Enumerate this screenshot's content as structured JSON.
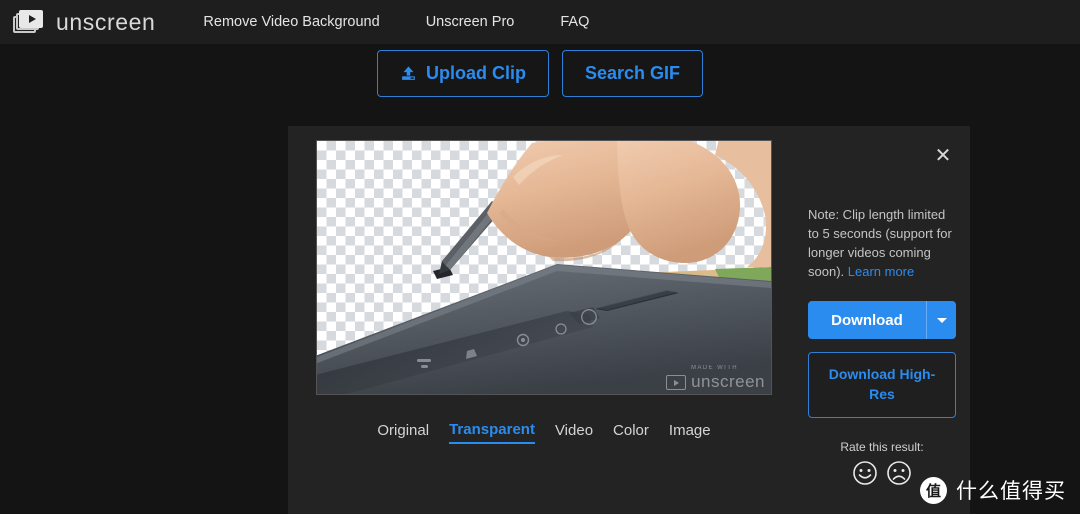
{
  "header": {
    "logo": {
      "text": "unscreen",
      "icon": "video-frames-play-icon"
    },
    "nav": [
      {
        "label": "Remove Video Background"
      },
      {
        "label": "Unscreen Pro"
      },
      {
        "label": "FAQ"
      }
    ]
  },
  "top_actions": {
    "upload": {
      "label": "Upload Clip",
      "icon": "upload-icon"
    },
    "search_gif": {
      "label": "Search GIF"
    }
  },
  "panel": {
    "close_label": "✕",
    "preview": {
      "background": "transparency-checkerboard",
      "description": "Hand pressing a small stylus tool into a dark gray tablet device",
      "watermark": {
        "made_with": "MADE WITH",
        "brand": "unscreen"
      }
    },
    "tabs": [
      {
        "label": "Original",
        "active": false
      },
      {
        "label": "Transparent",
        "active": true
      },
      {
        "label": "Video",
        "active": false
      },
      {
        "label": "Color",
        "active": false
      },
      {
        "label": "Image",
        "active": false
      }
    ],
    "note": {
      "text": "Note: Clip length limited to 5 seconds (support for longer videos coming soon). ",
      "link_label": "Learn more"
    },
    "download": {
      "label": "Download",
      "caret": "chevron-down-icon"
    },
    "download_high_res": {
      "label": "Download High-Res"
    },
    "rate": {
      "label": "Rate this result:",
      "positive_icon": "smiley-happy-icon",
      "negative_icon": "smiley-sad-icon"
    }
  },
  "site_watermark": {
    "badge": "值",
    "text": "什么值得买"
  },
  "colors": {
    "page_bg": "#141414",
    "header_bg": "#1e1e1e",
    "panel_bg": "#232323",
    "accent_blue": "#2b8cf0",
    "text_light": "#e4e4e4"
  }
}
